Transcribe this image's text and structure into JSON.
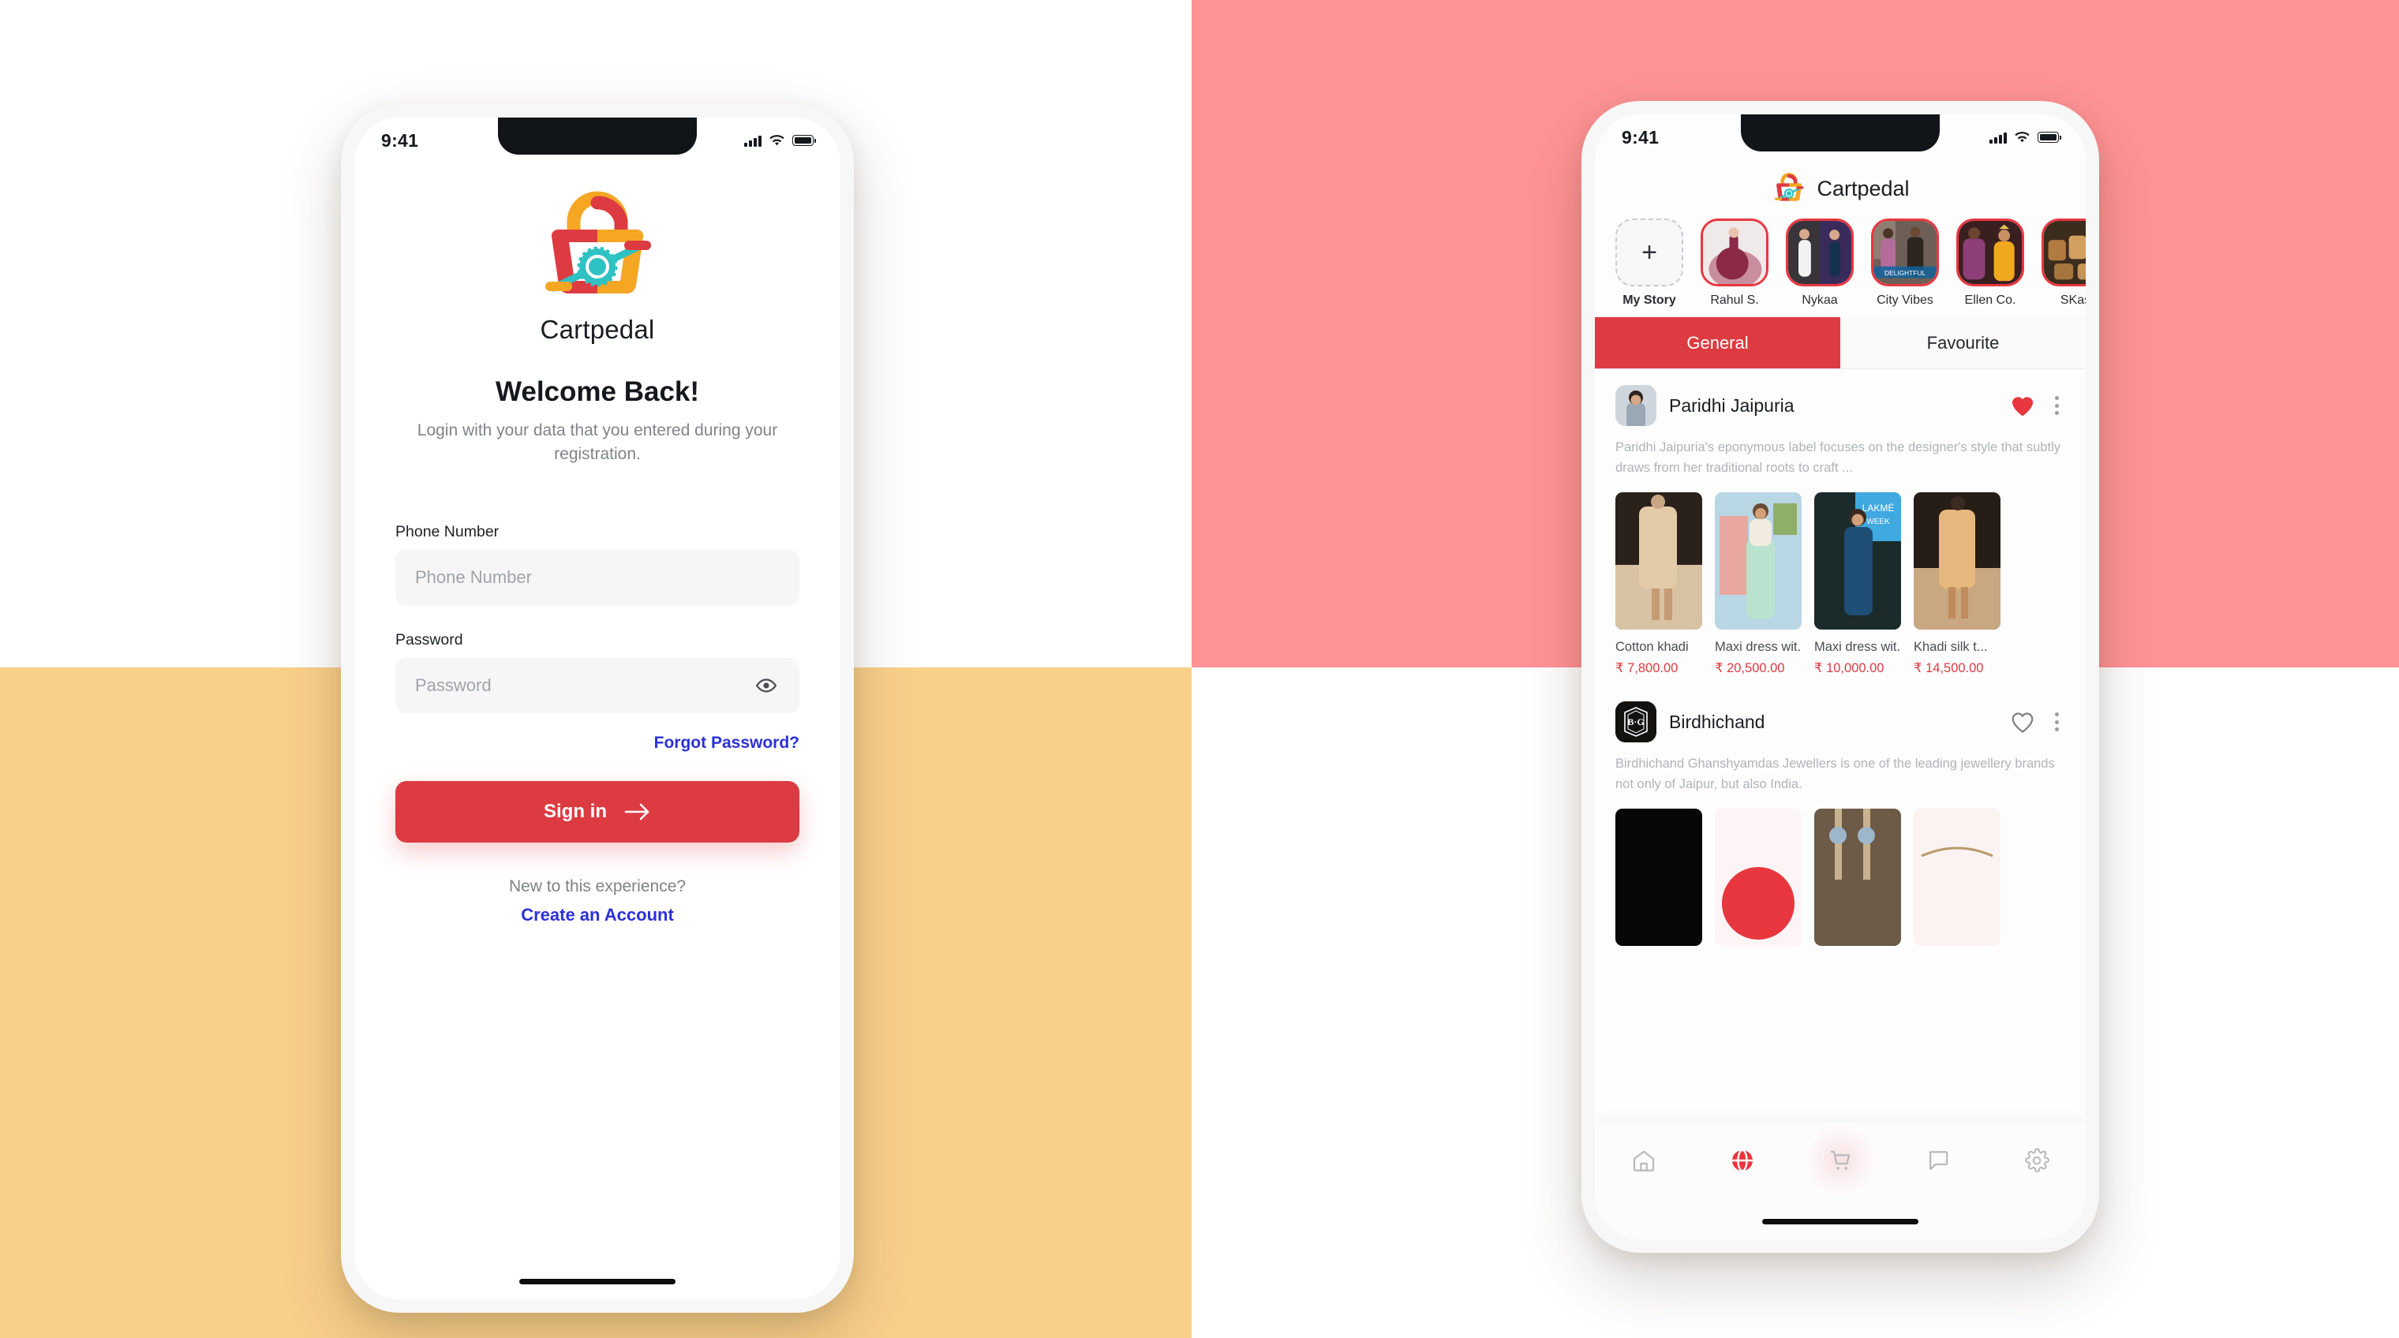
{
  "background": {
    "pink": "#FF9395",
    "gold": "#F9D08A",
    "white": "#FFFFFF"
  },
  "theme": {
    "accent_red": "#DD3B42",
    "link_blue": "#2B31D6",
    "logo_orange": "#F5A623",
    "logo_red": "#DD3B42",
    "logo_teal": "#2FC2C2",
    "muted_text": "#808389"
  },
  "login_screen": {
    "status_bar": {
      "time": "9:41",
      "signal_icon": "signal-bars-icon",
      "wifi_icon": "wifi-icon",
      "battery_icon": "battery-icon"
    },
    "logo_icon": "cartpedal-bag-pedal-logo",
    "brand_name": "Cartpedal",
    "heading": "Welcome Back!",
    "subtitle": "Login with your data that you entered during your registration.",
    "fields": [
      {
        "label": "Phone Number",
        "placeholder": "Phone Number",
        "value": "",
        "name": "phone"
      },
      {
        "label": "Password",
        "placeholder": "Password",
        "value": "",
        "name": "password",
        "trailing_icon": "eye-icon"
      }
    ],
    "forgot_password_label": "Forgot Password?",
    "signin_label": "Sign in",
    "signin_arrow_icon": "arrow-right-icon",
    "new_user_prompt": "New to this experience?",
    "create_account_label": "Create an Account"
  },
  "feed_screen": {
    "status_bar": {
      "time": "9:41",
      "signal_icon": "signal-bars-icon",
      "wifi_icon": "wifi-icon",
      "battery_icon": "battery-icon"
    },
    "header": {
      "logo_icon": "cartpedal-bag-pedal-logo",
      "title": "Cartpedal"
    },
    "stories": [
      {
        "label": "My Story",
        "type": "add",
        "icon": "plus-icon"
      },
      {
        "label": "Rahul S.",
        "type": "story"
      },
      {
        "label": "Nykaa",
        "type": "story"
      },
      {
        "label": "City Vibes",
        "type": "story"
      },
      {
        "label": "Ellen Co.",
        "type": "story"
      },
      {
        "label": "SKas",
        "type": "story"
      }
    ],
    "tabs": [
      {
        "label": "General",
        "active": true
      },
      {
        "label": "Favourite",
        "active": false
      }
    ],
    "cards": [
      {
        "brand": "Paridhi Jaipuria",
        "avatar_icon": "brand-avatar-photo",
        "favourite_icon": "heart-filled-icon",
        "favourited": true,
        "menu_icon": "kebab-menu-icon",
        "description": "Paridhi Jaipuria's eponymous label focuses on the designer's style that subtly draws from her traditional roots to craft ...",
        "products": [
          {
            "name": "Cotton khadi",
            "price": "₹ 7,800.00"
          },
          {
            "name": "Maxi dress wit...",
            "price": "₹ 20,500.00"
          },
          {
            "name": "Maxi dress wit...",
            "price": "₹ 10,000.00"
          },
          {
            "name": "Khadi silk t...",
            "price": "₹ 14,500.00"
          }
        ]
      },
      {
        "brand": "Birdhichand",
        "avatar_icon": "brand-logo-bg-monogram",
        "avatar_text": "B·G",
        "favourite_icon": "heart-outline-icon",
        "favourited": false,
        "menu_icon": "kebab-menu-icon",
        "description": "Birdhichand Ghanshyamdas Jewellers is one of the leading jewellery brands not only of Jaipur, but also India.",
        "products": [
          {
            "name": "",
            "price": ""
          },
          {
            "name": "",
            "price": ""
          },
          {
            "name": "",
            "price": ""
          },
          {
            "name": "",
            "price": ""
          }
        ]
      }
    ],
    "bottom_nav": [
      {
        "icon": "home-icon",
        "active": false
      },
      {
        "icon": "globe-icon",
        "active": true
      },
      {
        "icon": "cart-icon",
        "active": false,
        "glow": true
      },
      {
        "icon": "chat-bubble-icon",
        "active": false
      },
      {
        "icon": "gear-icon",
        "active": false
      }
    ]
  }
}
